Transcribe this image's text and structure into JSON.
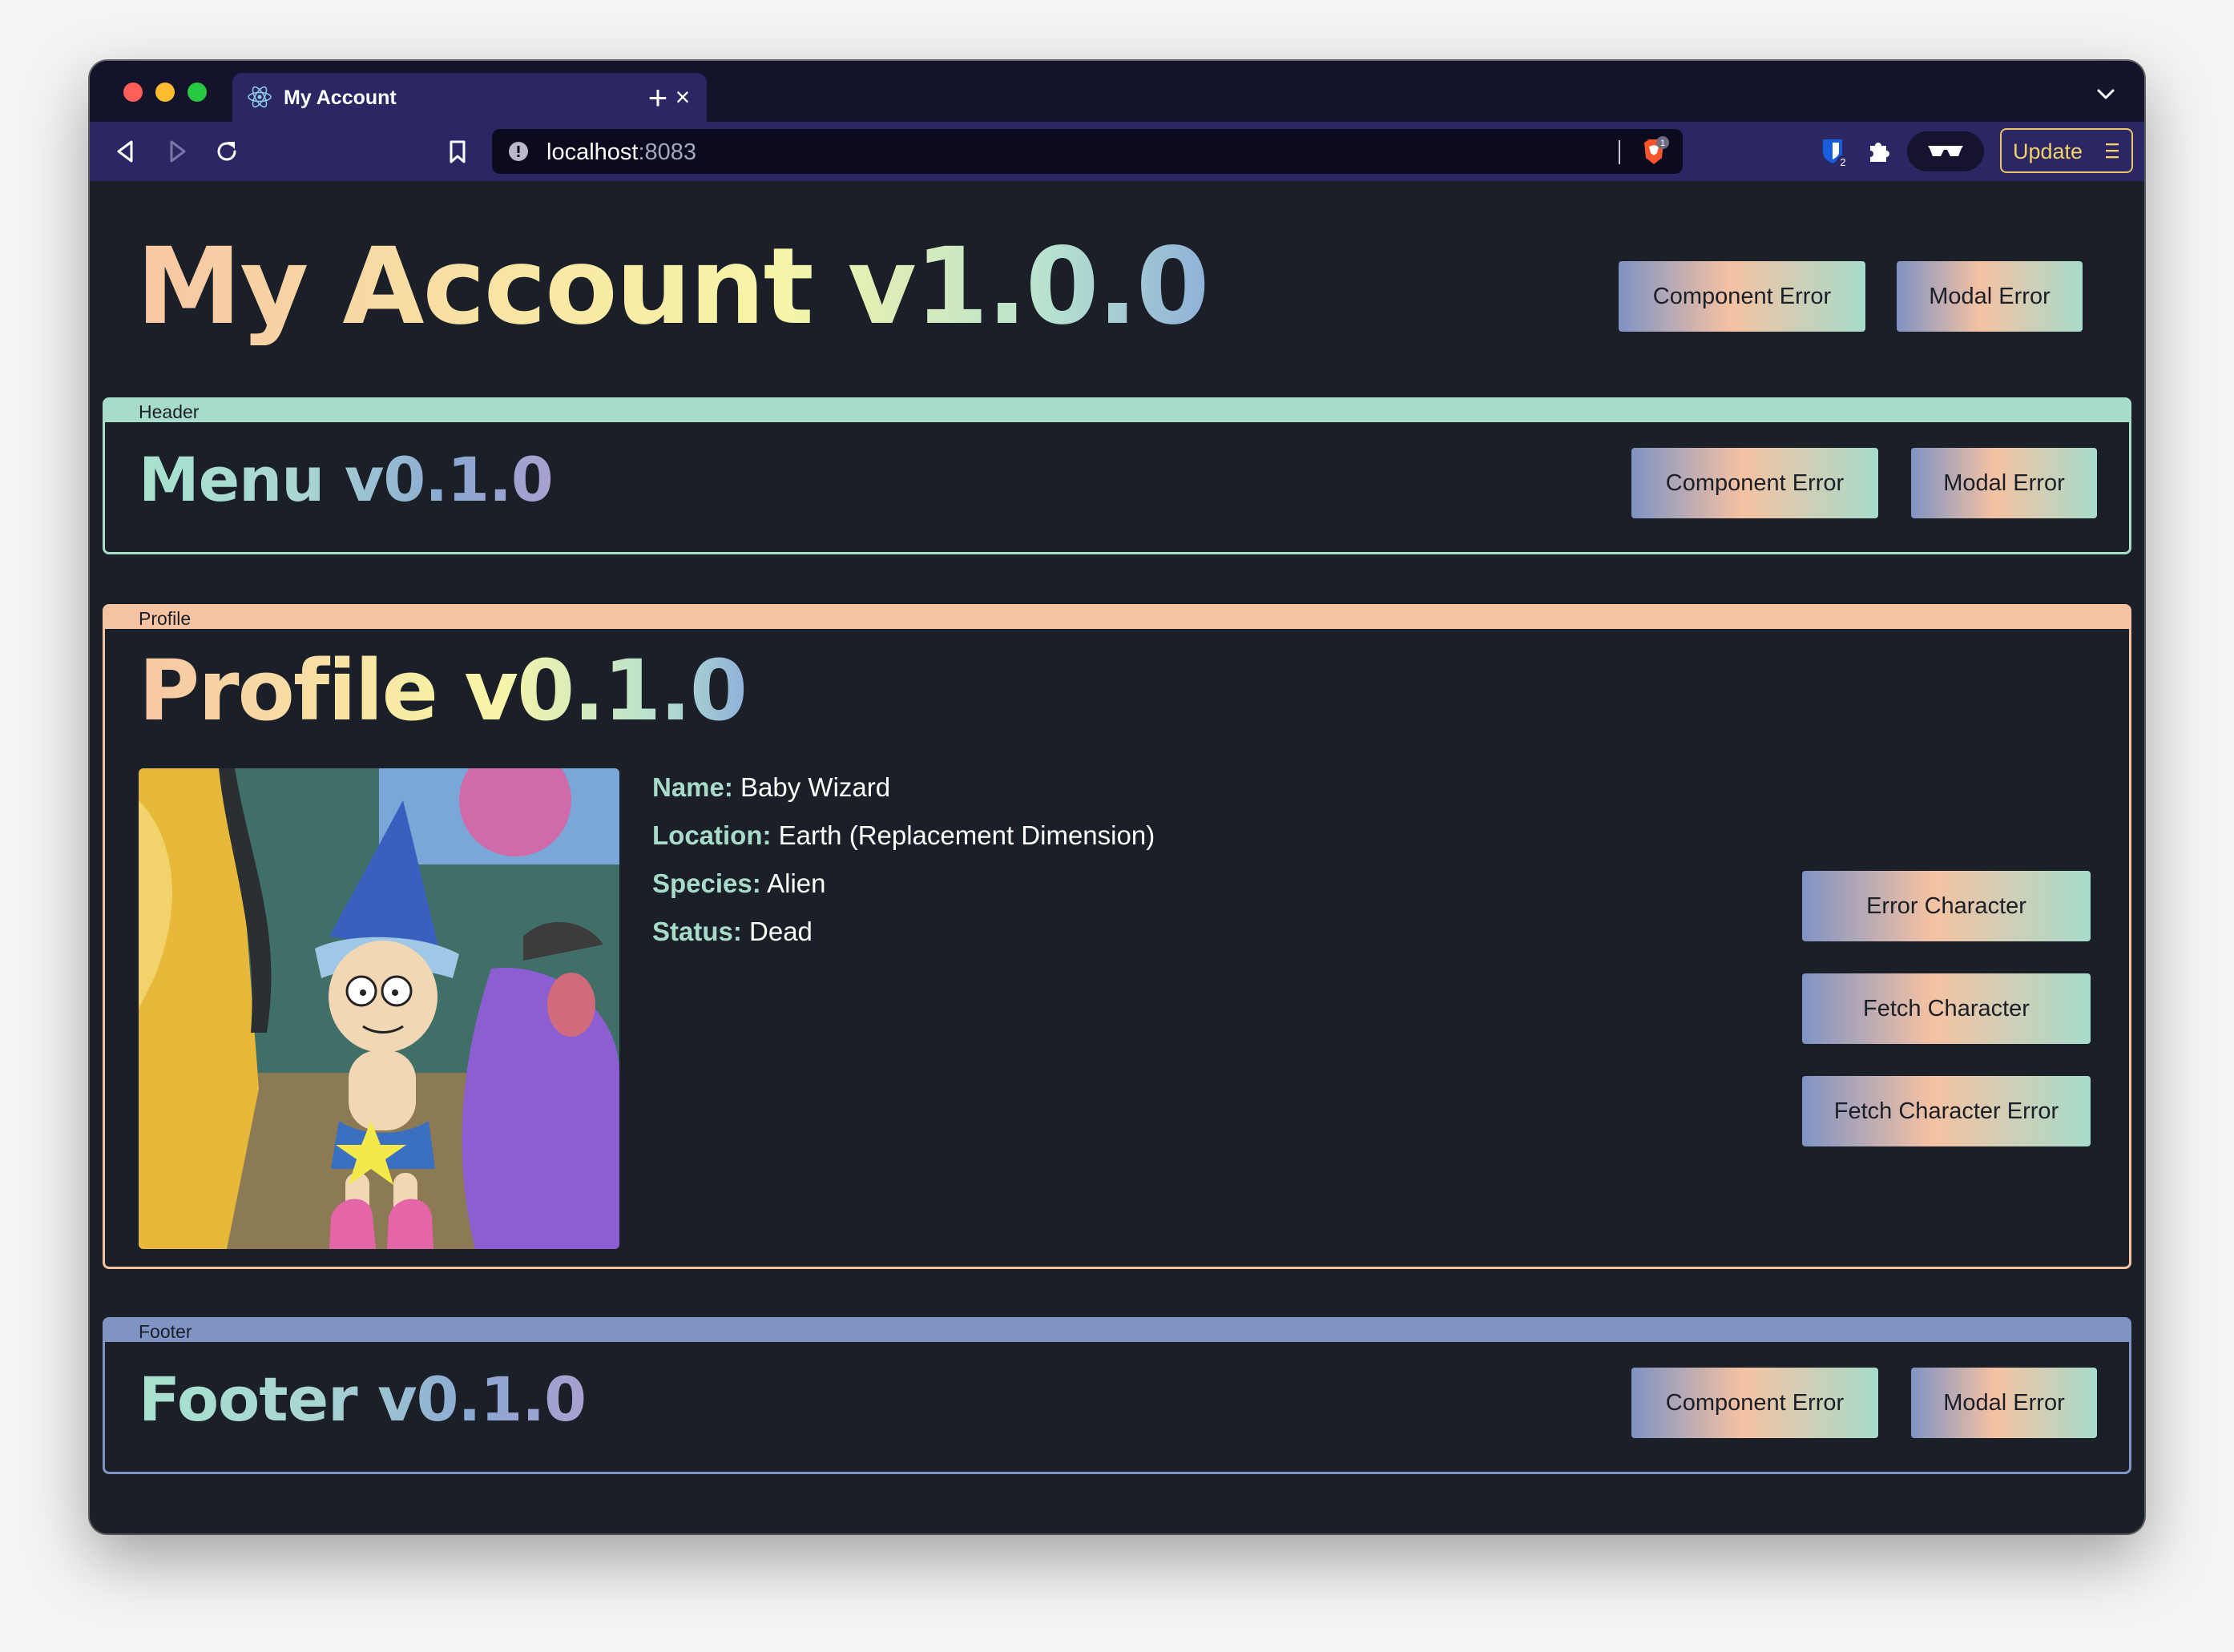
{
  "browser": {
    "tab_title": "My Account",
    "tab_close": "×",
    "new_tab": "+",
    "url_host": "localhost",
    "url_port": ":8083",
    "brave_badge": "1",
    "bitwarden_badge": "2",
    "update_label": "Update"
  },
  "app": {
    "title": "My Account v1.0.0",
    "component_error": "Component Error",
    "modal_error": "Modal Error"
  },
  "header": {
    "tab_label": "Header",
    "title": "Menu v0.1.0",
    "component_error": "Component Error",
    "modal_error": "Modal Error"
  },
  "profile": {
    "tab_label": "Profile",
    "title": "Profile v0.1.0",
    "fields": [
      {
        "key": "Name:",
        "value": "Baby Wizard"
      },
      {
        "key": "Location:",
        "value": "Earth (Replacement Dimension)"
      },
      {
        "key": "Species:",
        "value": "Alien"
      },
      {
        "key": "Status:",
        "value": "Dead"
      }
    ],
    "buttons": {
      "error_character": "Error Character",
      "fetch_character": "Fetch Character",
      "fetch_character_error": "Fetch Character Error"
    }
  },
  "footer": {
    "tab_label": "Footer",
    "title": "Footer v0.1.0",
    "component_error": "Component Error",
    "modal_error": "Modal Error"
  },
  "colors": {
    "header_accent": "#a7dccb",
    "profile_accent": "#f5c2a2",
    "footer_accent": "#7f93c4",
    "page_background": "#1b1f27",
    "browser_chrome": "#2b2664"
  },
  "icons": [
    "react-icon",
    "back-arrow-icon",
    "forward-arrow-icon",
    "reload-icon",
    "bookmark-icon",
    "site-info-icon",
    "brave-shield-icon",
    "bitwarden-icon",
    "puzzle-icon",
    "glasses-icon",
    "hamburger-menu-icon",
    "chevron-down-icon"
  ]
}
